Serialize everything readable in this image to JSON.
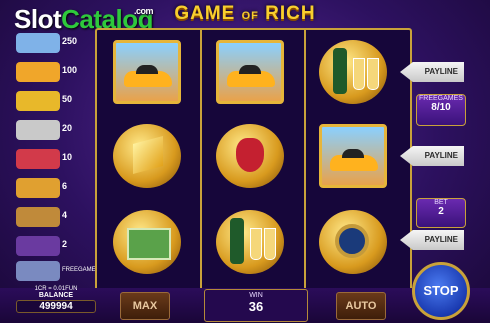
{
  "watermark": {
    "part1": "Slot",
    "part2": "Catalog",
    "suffix": ".com"
  },
  "game_title": {
    "main1": "GAME ",
    "of": "OF",
    "main2": " RICH"
  },
  "paytable": [
    {
      "icon": "wild-icon",
      "value": "250",
      "color": "#7fb2e8"
    },
    {
      "icon": "car-icon",
      "value": "100",
      "color": "#f0a62a"
    },
    {
      "icon": "gold-bars-icon",
      "value": "50",
      "color": "#e8b82a"
    },
    {
      "icon": "coins-icon",
      "value": "20",
      "color": "#c9c9c9"
    },
    {
      "icon": "ring-icon",
      "value": "10",
      "color": "#d23a4a"
    },
    {
      "icon": "champagne-icon",
      "value": "6",
      "color": "#e0a030"
    },
    {
      "icon": "watch-icon",
      "value": "4",
      "color": "#c08a3a"
    },
    {
      "icon": "cash-icon",
      "value": "2",
      "color": "#6a3aa0"
    },
    {
      "icon": "scatter-icon",
      "value": "FREEGAMES",
      "color": "#7a8ac0"
    }
  ],
  "reels": [
    [
      "car-icon",
      "gold-bars-icon",
      "cash-icon"
    ],
    [
      "car-icon",
      "money-bag-icon",
      "champagne-icon"
    ],
    [
      "champagne-icon",
      "car-icon",
      "watch-icon"
    ]
  ],
  "paylines": [
    "PAYLINE",
    "PAYLINE",
    "PAYLINE"
  ],
  "freegames": {
    "label": "FREEGAMES",
    "value": "8/10"
  },
  "bet": {
    "label": "BET",
    "value": "2"
  },
  "balance": {
    "rate": "1CR = 0.01FUN",
    "label": "BALANCE",
    "value": "499994"
  },
  "buttons": {
    "max": "MAX",
    "auto": "AUTO",
    "stop": "STOP"
  },
  "win": {
    "label": "WIN",
    "value": "36"
  },
  "colors": {
    "gold": "#c9a23a",
    "background": "#2d1160",
    "title": "#f8cf2e"
  }
}
